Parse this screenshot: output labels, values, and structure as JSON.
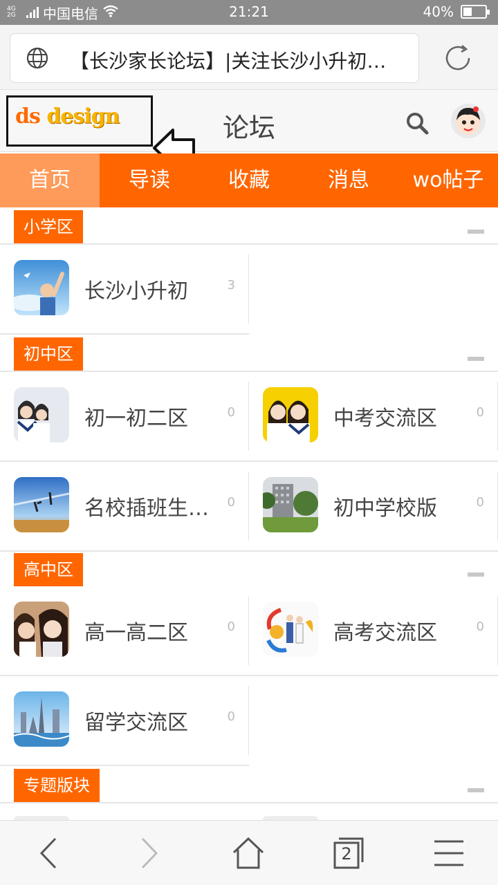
{
  "status_bar": {
    "network": "4G 2G",
    "carrier": "中国电信",
    "time": "21:21",
    "battery": "40%",
    "battery_level": 0.4
  },
  "browser": {
    "url_title": "【长沙家长论坛】|关注长沙小升初…"
  },
  "header": {
    "logo_ds": "ds",
    "logo_design": " design",
    "title": "论坛"
  },
  "nav": {
    "tabs": [
      "首页",
      "导读",
      "收藏",
      "消息",
      "wo帖子"
    ],
    "active_index": 0
  },
  "sections": [
    {
      "title": "小学区",
      "forums": [
        {
          "name": "长沙小升初",
          "count": "3"
        }
      ]
    },
    {
      "title": "初中区",
      "forums": [
        {
          "name": "初一初二区",
          "count": "0"
        },
        {
          "name": "中考交流区",
          "count": "0"
        },
        {
          "name": "名校插班生考…",
          "count": "0"
        },
        {
          "name": "初中学校版",
          "count": "0"
        }
      ]
    },
    {
      "title": "高中区",
      "forums": [
        {
          "name": "高一高二区",
          "count": "0"
        },
        {
          "name": "高考交流区",
          "count": "0"
        },
        {
          "name": "留学交流区",
          "count": "0"
        }
      ]
    },
    {
      "title": "专题版块",
      "forums": []
    }
  ],
  "colors": {
    "accent": "#ff6600",
    "accent_active": "#ff9b5a",
    "status_bar": "#8c8c8c"
  },
  "icons": {
    "browser": "globe-icon",
    "reload": "reload-icon",
    "search": "search-icon",
    "annotation": "arrow-left-icon",
    "bottom": [
      "back-icon",
      "forward-icon",
      "home-icon",
      "tabs-icon",
      "menu-icon"
    ]
  },
  "bottom_bar": {
    "tab_count": "2"
  }
}
